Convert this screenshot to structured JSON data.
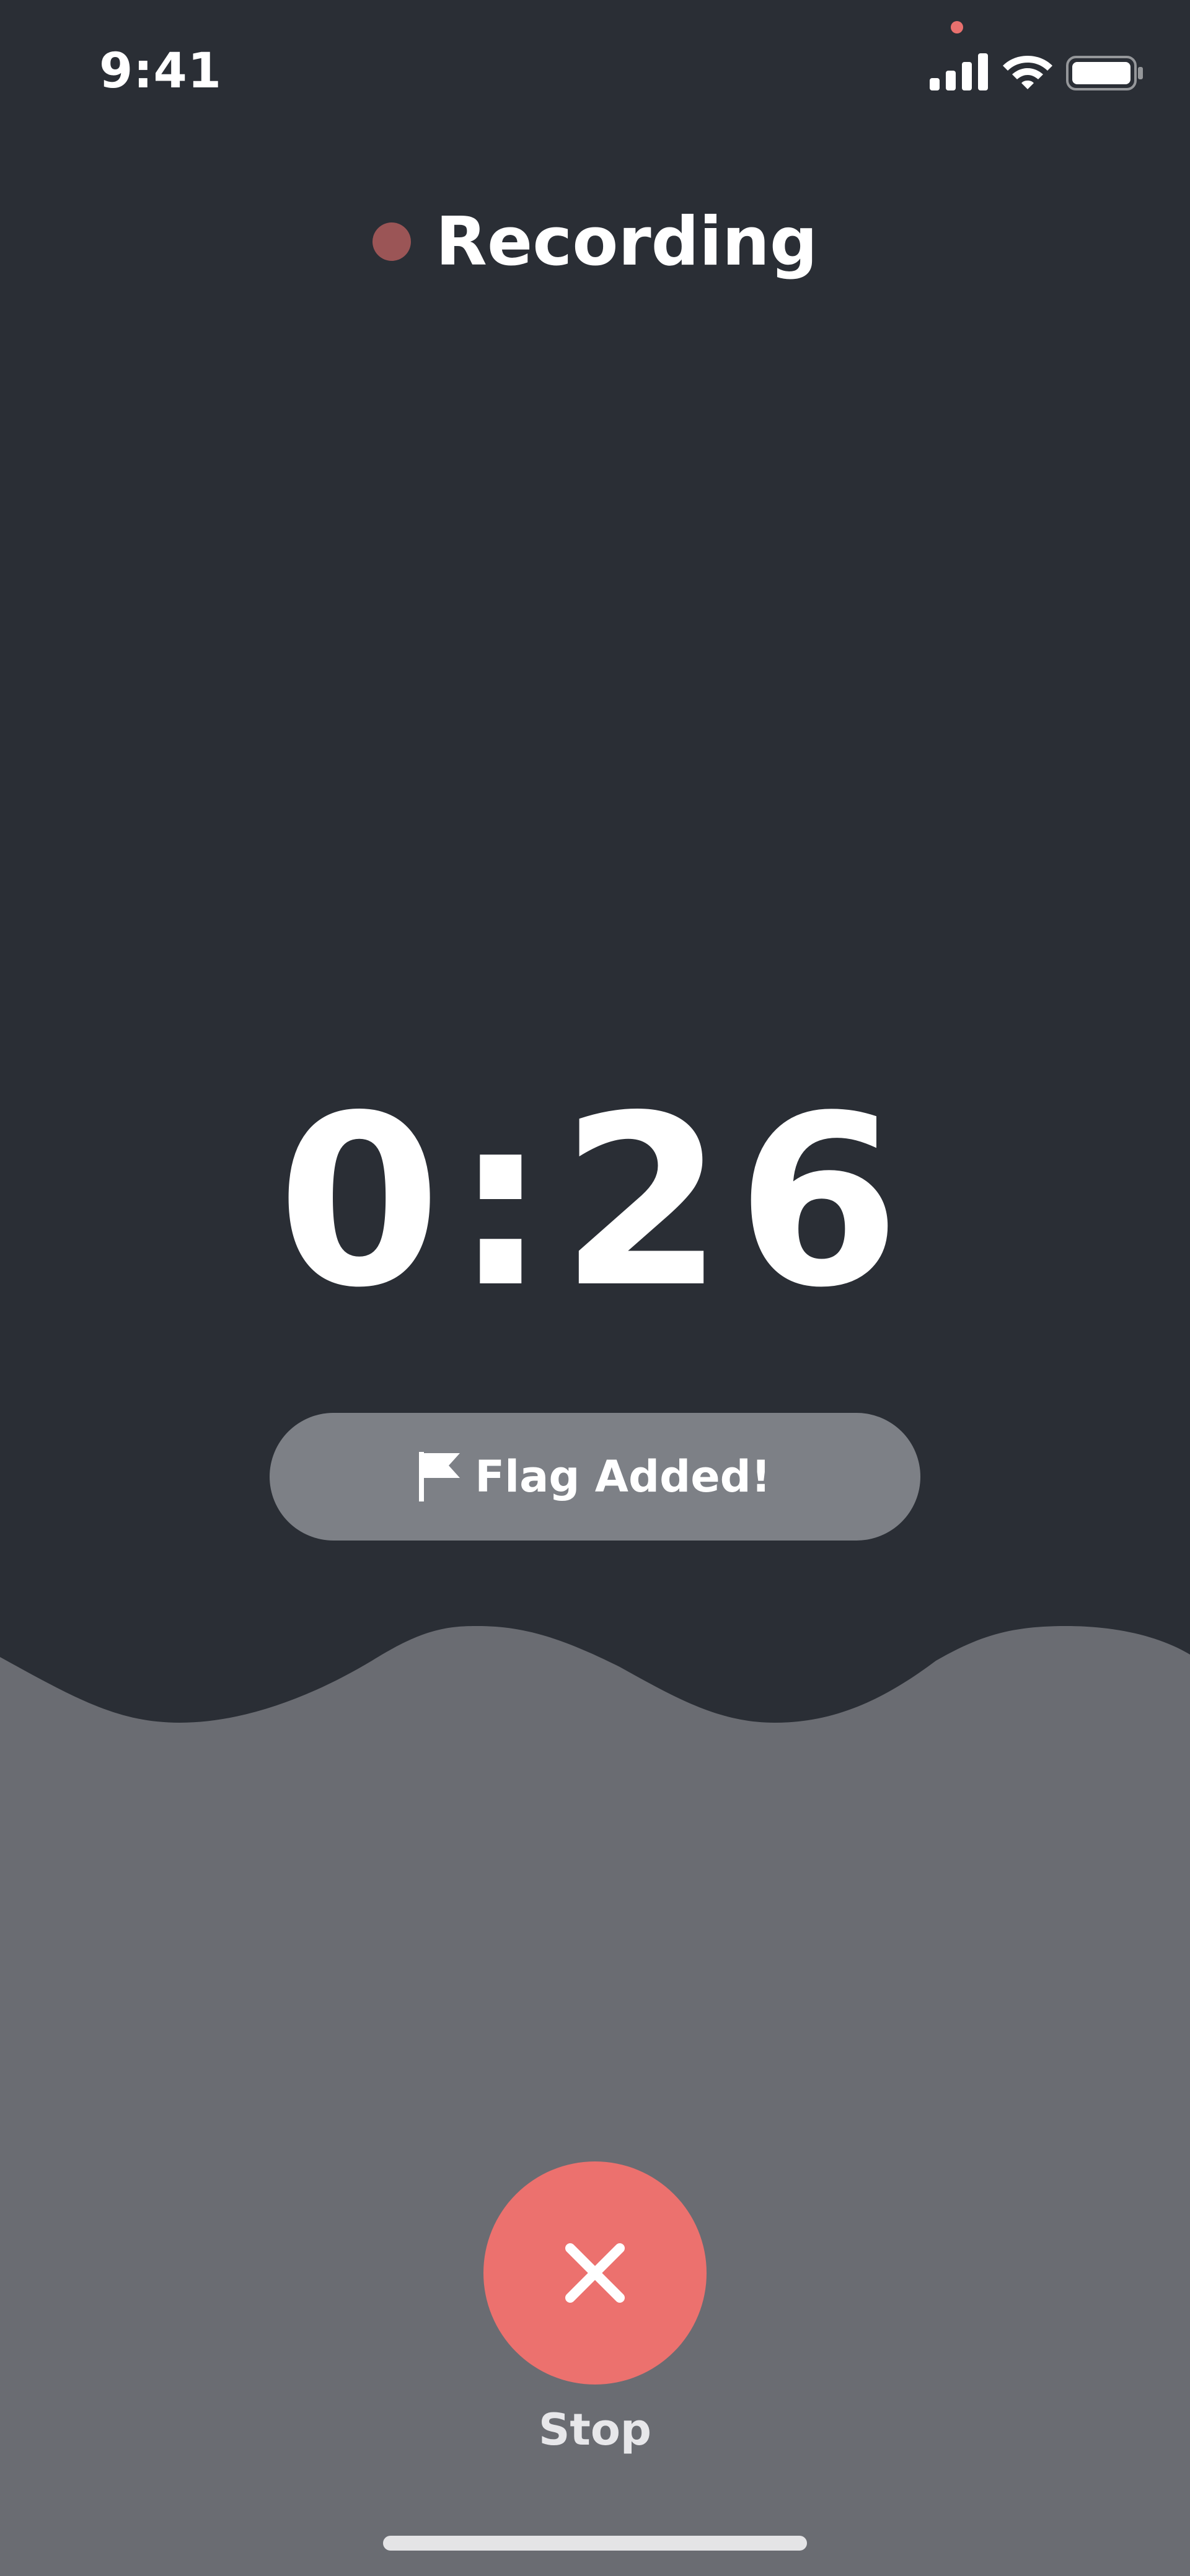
{
  "status_bar": {
    "time": "9:41"
  },
  "header": {
    "title": "Recording",
    "indicator_color": "#9b5556"
  },
  "timer": {
    "display": "0:26"
  },
  "flag_toast": {
    "label": "Flag Added!",
    "icon": "flag-icon",
    "background": "#7d8086"
  },
  "controls": {
    "stop_label": "Stop",
    "stop_icon": "close-icon",
    "stop_color": "#ec716e"
  },
  "colors": {
    "top_background": "#2a2e35",
    "bottom_background": "#6a6c72",
    "privacy_dot": "#e8706e"
  }
}
